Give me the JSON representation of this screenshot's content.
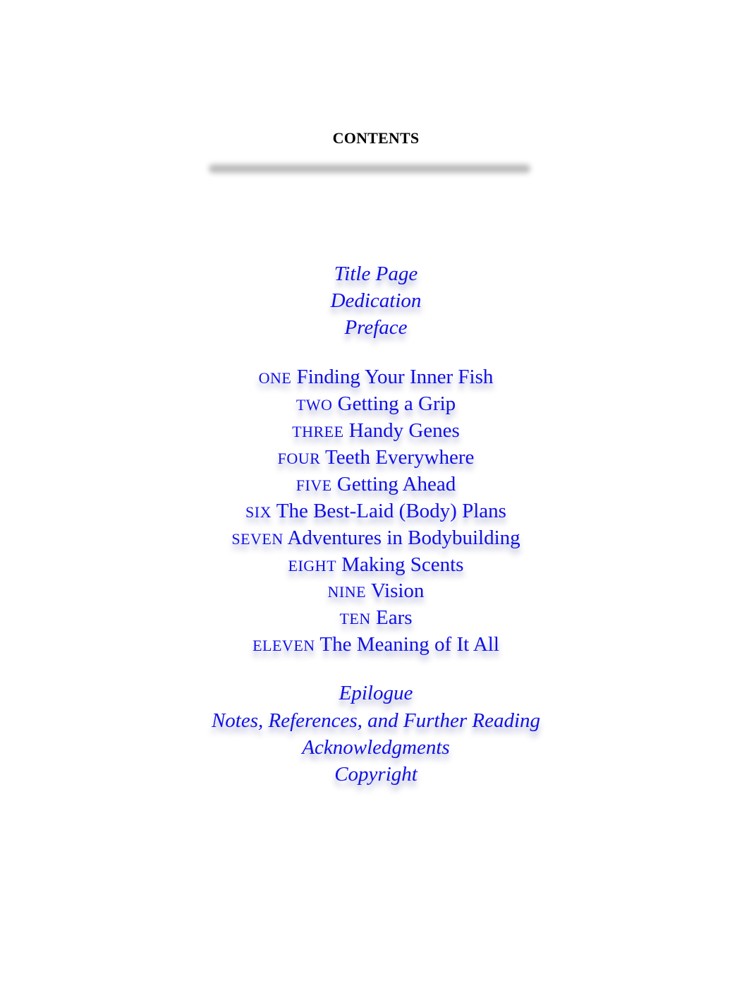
{
  "heading": "CONTENTS",
  "colors": {
    "link": "#1010e6",
    "heading": "#000000",
    "rule": "#b9b9b9"
  },
  "front_matter": [
    {
      "label": "Title Page"
    },
    {
      "label": "Dedication"
    },
    {
      "label": "Preface"
    }
  ],
  "chapters": [
    {
      "number": "ONE",
      "title": "Finding Your Inner Fish"
    },
    {
      "number": "TWO",
      "title": "Getting a Grip"
    },
    {
      "number": "THREE",
      "title": "Handy Genes"
    },
    {
      "number": "FOUR",
      "title": "Teeth Everywhere"
    },
    {
      "number": "FIVE",
      "title": "Getting Ahead"
    },
    {
      "number": "SIX",
      "title": "The Best-Laid (Body) Plans"
    },
    {
      "number": "SEVEN",
      "title": "Adventures in Bodybuilding"
    },
    {
      "number": "EIGHT",
      "title": "Making Scents"
    },
    {
      "number": "NINE",
      "title": "Vision"
    },
    {
      "number": "TEN",
      "title": "Ears"
    },
    {
      "number": "ELEVEN",
      "title": "The Meaning of It All"
    }
  ],
  "back_matter": [
    {
      "label": "Epilogue"
    },
    {
      "label": "Notes, References, and Further Reading"
    },
    {
      "label": "Acknowledgments"
    },
    {
      "label": "Copyright"
    }
  ]
}
